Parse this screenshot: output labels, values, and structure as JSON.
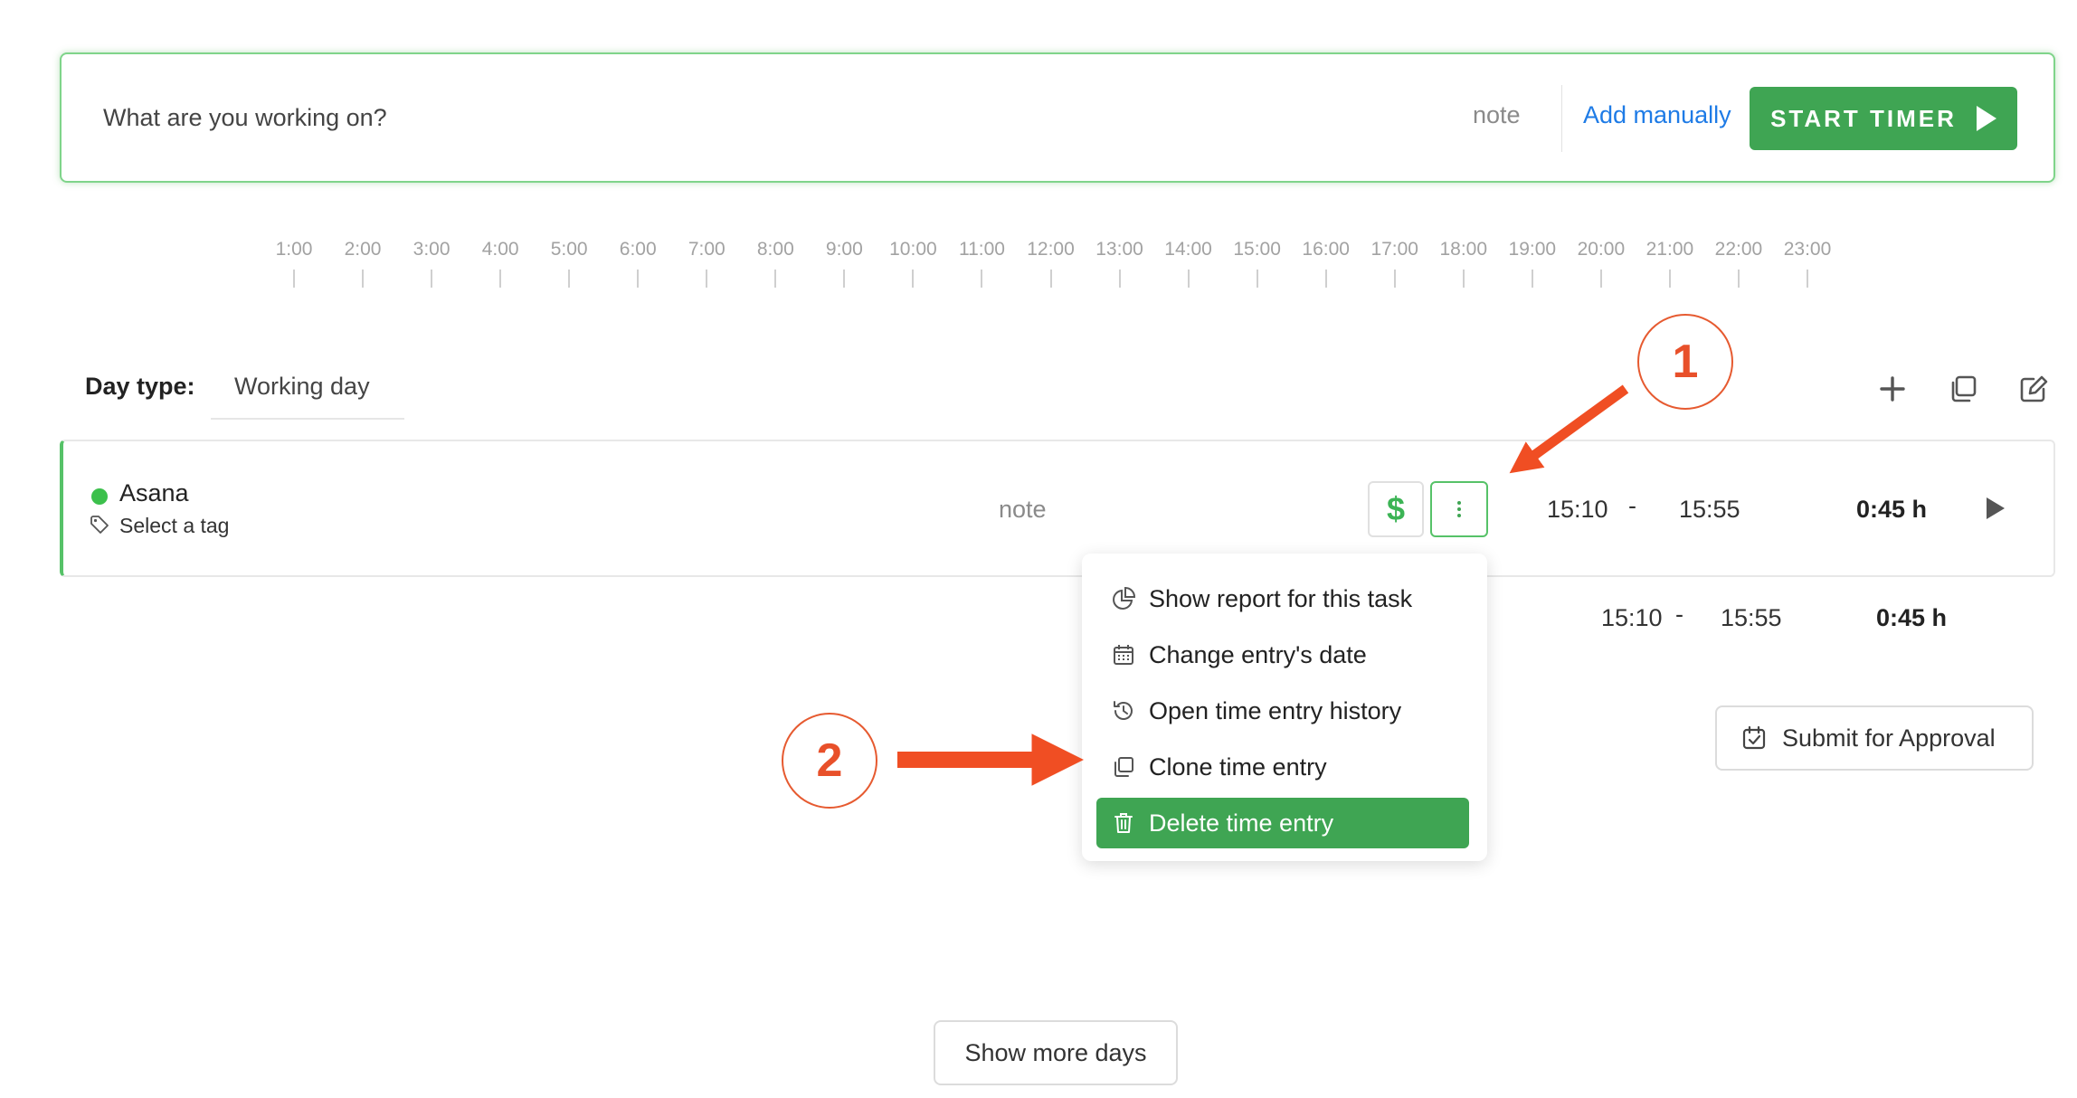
{
  "timer": {
    "placeholder": "What are you working on?",
    "note": "note",
    "add_manually": "Add manually",
    "start_label": "START TIMER"
  },
  "ruler": {
    "hours": [
      "1:00",
      "2:00",
      "3:00",
      "4:00",
      "5:00",
      "6:00",
      "7:00",
      "8:00",
      "9:00",
      "10:00",
      "11:00",
      "12:00",
      "13:00",
      "14:00",
      "15:00",
      "16:00",
      "17:00",
      "18:00",
      "19:00",
      "20:00",
      "21:00",
      "22:00",
      "23:00"
    ]
  },
  "day": {
    "type_label": "Day type:",
    "type_value": "Working day"
  },
  "toolbar": {
    "icons": [
      "plus-icon",
      "copy-icon",
      "edit-icon"
    ]
  },
  "entry": {
    "project": "Asana",
    "project_color": "#3cc04c",
    "tag_placeholder": "Select a tag",
    "note": "note",
    "billable_symbol": "$",
    "start": "15:10",
    "separator": "-",
    "end": "15:55",
    "duration": "0:45 h"
  },
  "totals": {
    "start": "15:10",
    "separator": "-",
    "end": "15:55",
    "duration": "0:45 h"
  },
  "menu": {
    "items": [
      {
        "label": "Show report for this task",
        "icon": "pie-chart-icon"
      },
      {
        "label": "Change entry's date",
        "icon": "calendar-icon"
      },
      {
        "label": "Open time entry history",
        "icon": "history-icon"
      },
      {
        "label": "Clone time entry",
        "icon": "clone-icon"
      },
      {
        "label": "Delete time entry",
        "icon": "trash-icon"
      }
    ]
  },
  "submit_label": "Submit for Approval",
  "show_more_label": "Show more days",
  "annotations": {
    "badge_1": "1",
    "badge_2": "2",
    "color": "#f04e23"
  },
  "colors": {
    "accent_green": "#3fa553",
    "link_blue": "#1e7be6"
  }
}
